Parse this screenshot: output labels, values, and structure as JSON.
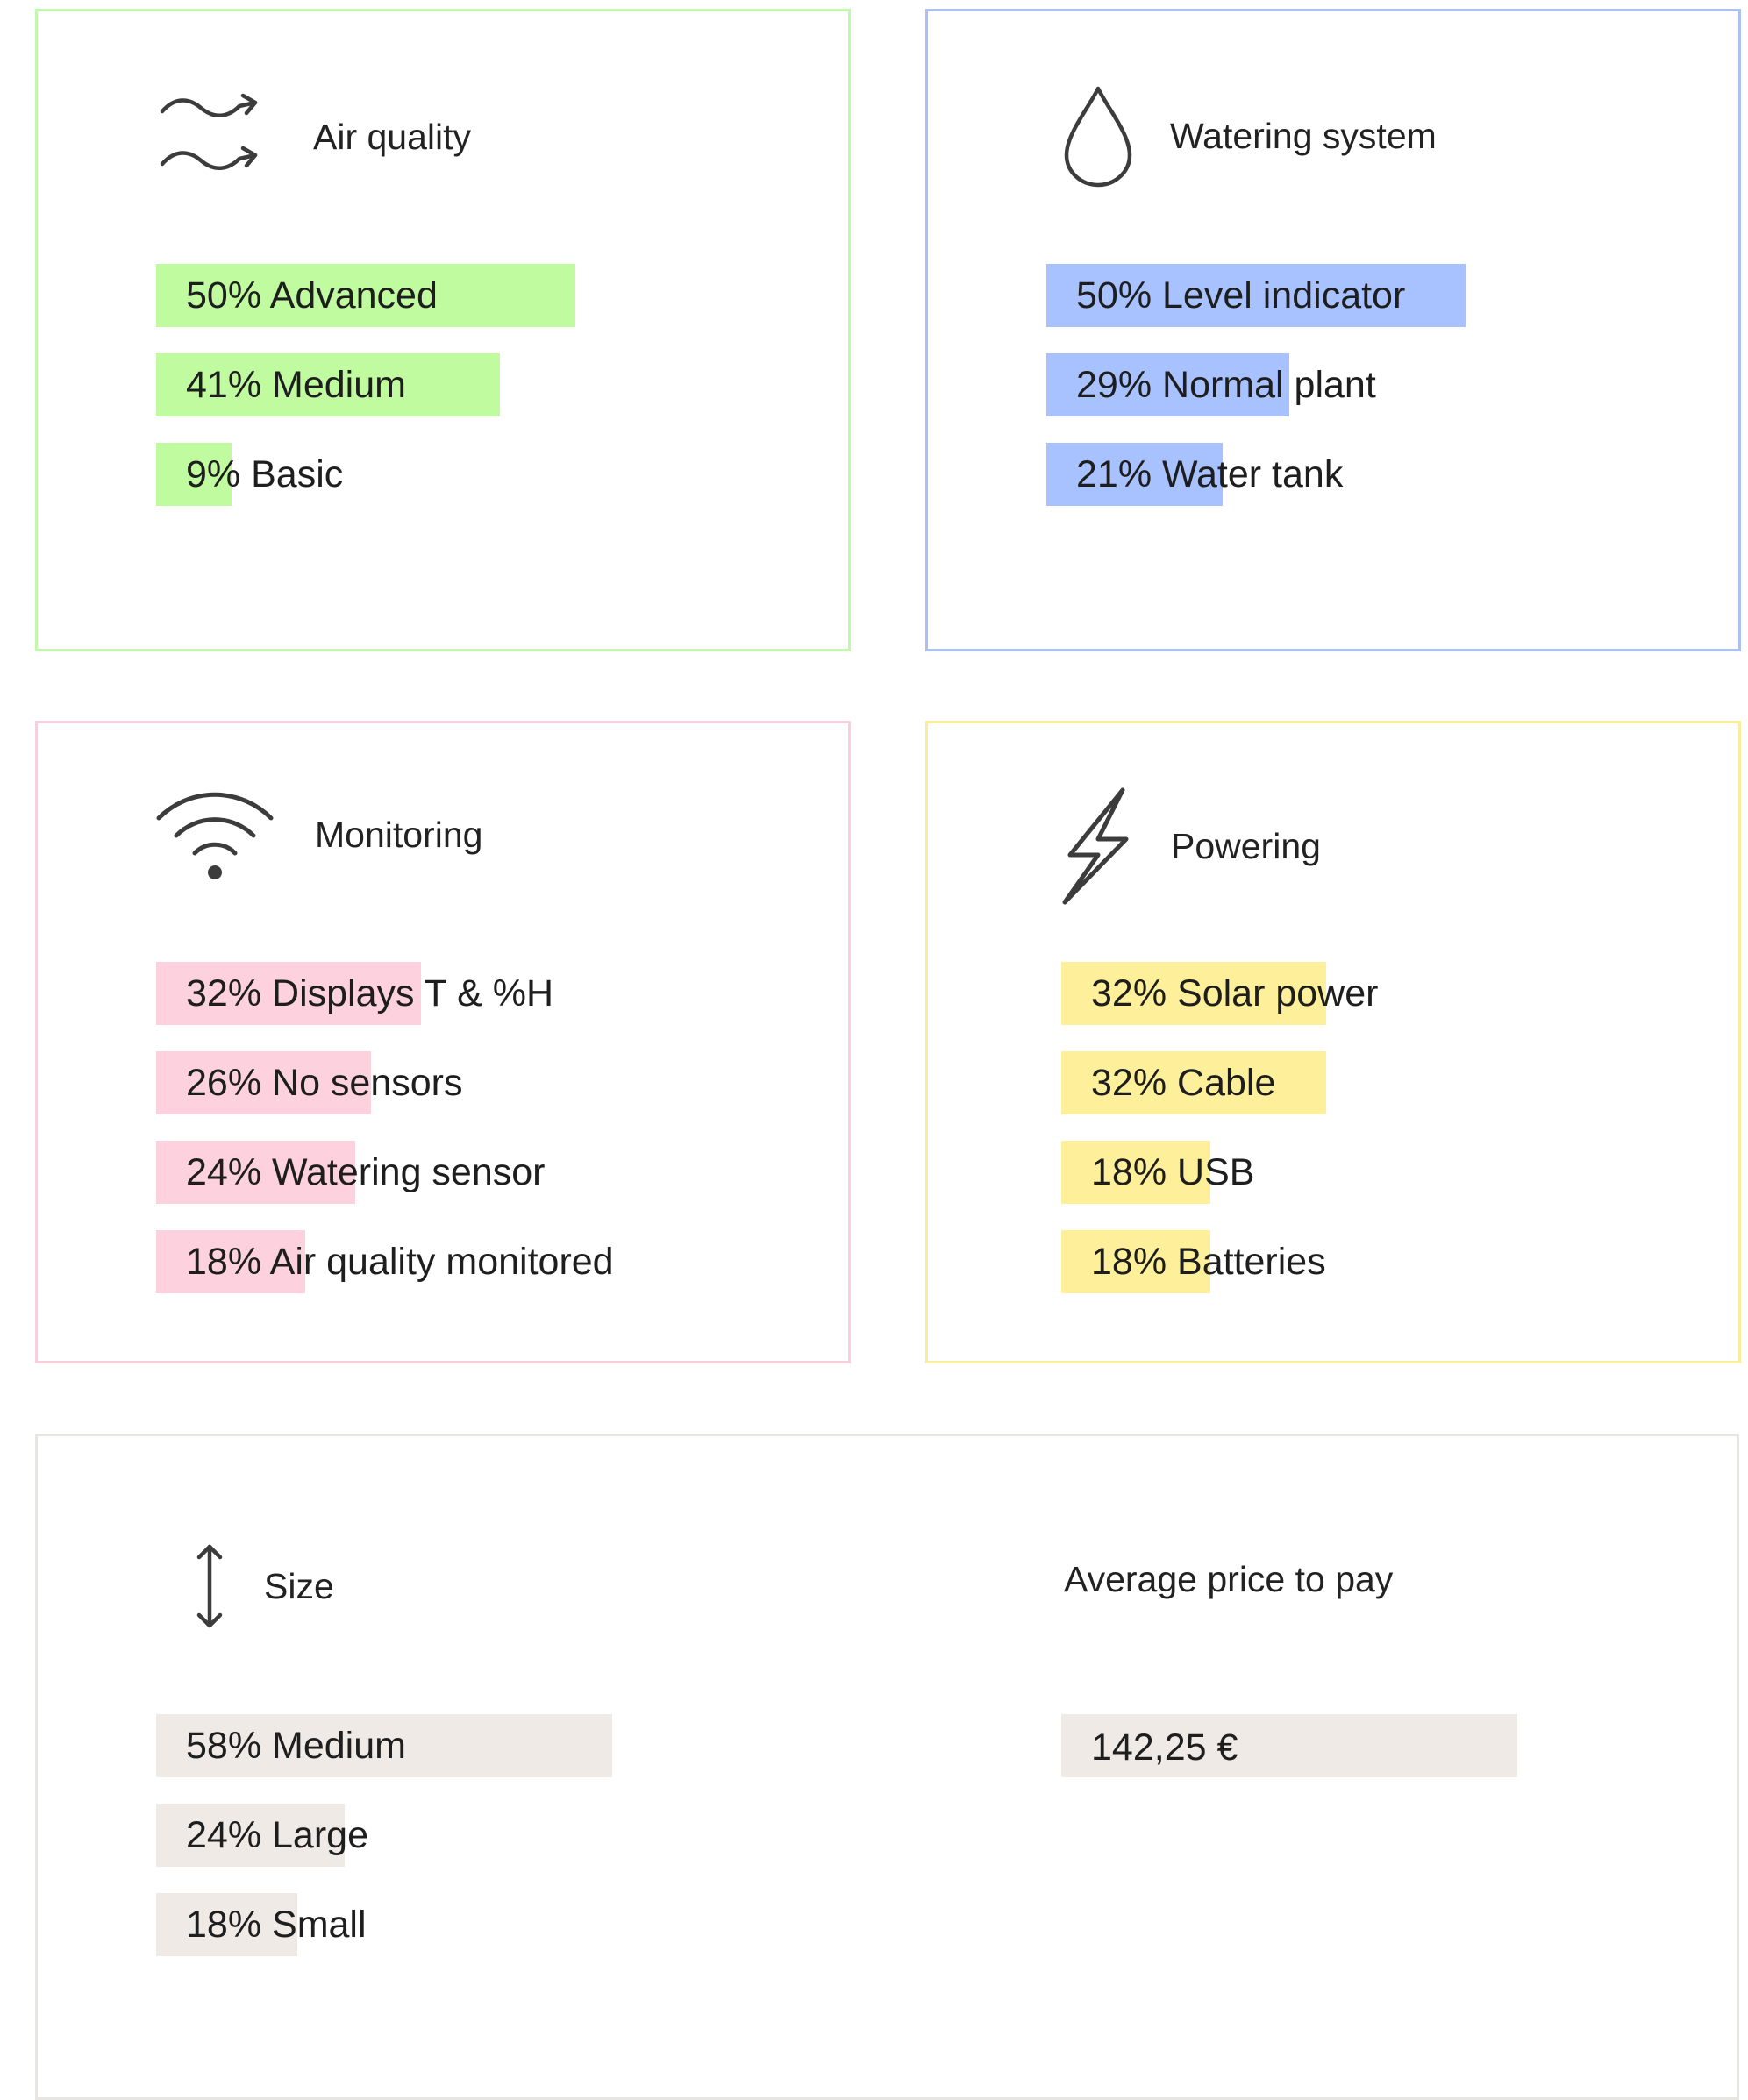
{
  "colors": {
    "green": "#c0fba0",
    "green_border": "#c3f7ae",
    "blue": "#a8c1ff",
    "blue_border": "#aac1f2",
    "pink": "#fdd2de",
    "pink_border": "#f8d0dc",
    "yellow": "#fef09b",
    "yellow_border": "#f8ee9d",
    "beige": "#efeae6",
    "beige_border": "#e8e6e3",
    "icon_stroke": "#3c3c3c"
  },
  "chart_data": [
    {
      "type": "bar",
      "title": "Air quality",
      "icon": "air-waves-icon",
      "categories": [
        "Advanced",
        "Medium",
        "Basic"
      ],
      "values": [
        50,
        41,
        9
      ],
      "labels": [
        "50% Advanced",
        "41% Medium",
        "9% Basic"
      ]
    },
    {
      "type": "bar",
      "title": "Watering system",
      "icon": "water-drop-icon",
      "categories": [
        "Level indicator",
        "Normal plant",
        "Water tank"
      ],
      "values": [
        50,
        29,
        21
      ],
      "labels": [
        "50% Level indicator",
        "29% Normal plant",
        "21% Water tank"
      ]
    },
    {
      "type": "bar",
      "title": "Monitoring",
      "icon": "wifi-icon",
      "categories": [
        "Displays T & %H",
        "No sensors",
        "Watering sensor",
        "Air quality monitored"
      ],
      "values": [
        32,
        26,
        24,
        18
      ],
      "labels": [
        "32% Displays T & %H",
        "26% No sensors",
        "24% Watering sensor",
        "18% Air quality monitored"
      ]
    },
    {
      "type": "bar",
      "title": "Powering",
      "icon": "lightning-icon",
      "categories": [
        "Solar power",
        "Cable",
        "USB",
        "Batteries"
      ],
      "values": [
        32,
        32,
        18,
        18
      ],
      "labels": [
        "32% Solar power",
        "32% Cable",
        "18% USB",
        "18% Batteries"
      ]
    },
    {
      "type": "bar",
      "title": "Size",
      "icon": "vertical-arrows-icon",
      "categories": [
        "Medium",
        "Large",
        "Small"
      ],
      "values": [
        58,
        24,
        18
      ],
      "labels": [
        "58% Medium",
        "24% Large",
        "18% Small"
      ]
    }
  ],
  "price": {
    "title": "Average price to pay",
    "value": "142,25 €"
  }
}
